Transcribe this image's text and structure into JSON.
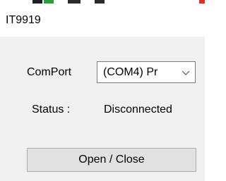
{
  "window": {
    "title": "IT9919"
  },
  "form": {
    "comport_label": "ComPort",
    "comport_value": "(COM4) Pr",
    "status_label": "Status :",
    "status_value": "Disconnected",
    "open_close_label": "Open / Close"
  },
  "icons": {
    "dropdown": "chevron-down-icon"
  }
}
